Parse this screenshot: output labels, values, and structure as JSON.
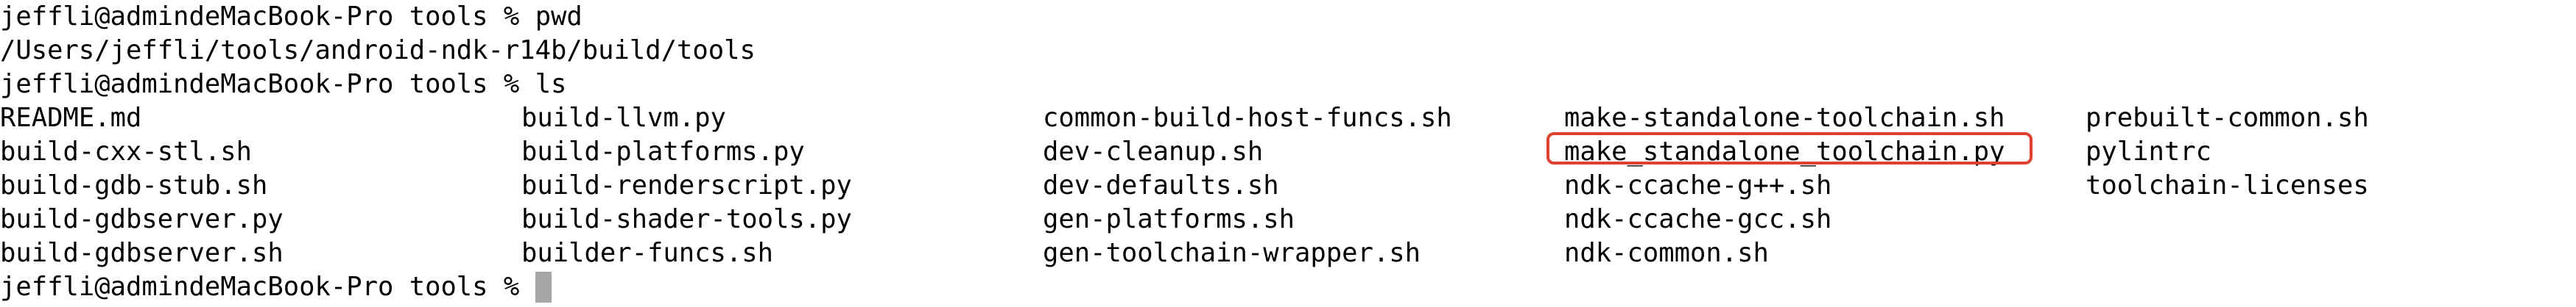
{
  "prompt": "jeffli@admindeMacBook-Pro tools % ",
  "commands": {
    "pwd": "pwd",
    "ls": "ls"
  },
  "pwd_output": "/Users/jeffli/tools/android-ndk-r14b/build/tools",
  "ls_output": {
    "col0": [
      "README.md",
      "build-cxx-stl.sh",
      "build-gdb-stub.sh",
      "build-gdbserver.py",
      "build-gdbserver.sh"
    ],
    "col1": [
      "build-llvm.py",
      "build-platforms.py",
      "build-renderscript.py",
      "build-shader-tools.py",
      "builder-funcs.sh"
    ],
    "col2": [
      "common-build-host-funcs.sh",
      "dev-cleanup.sh",
      "dev-defaults.sh",
      "gen-platforms.sh",
      "gen-toolchain-wrapper.sh"
    ],
    "col3": [
      "make-standalone-toolchain.sh",
      "make_standalone_toolchain.py",
      "ndk-ccache-g++.sh",
      "ndk-ccache-gcc.sh",
      "ndk-common.sh"
    ],
    "col4": [
      "prebuilt-common.sh",
      "pylintrc",
      "toolchain-licenses"
    ]
  },
  "highlight": {
    "file": "make_standalone_toolchain.py",
    "color": "#e0402e"
  },
  "cursor_color": "#a6a6a6"
}
